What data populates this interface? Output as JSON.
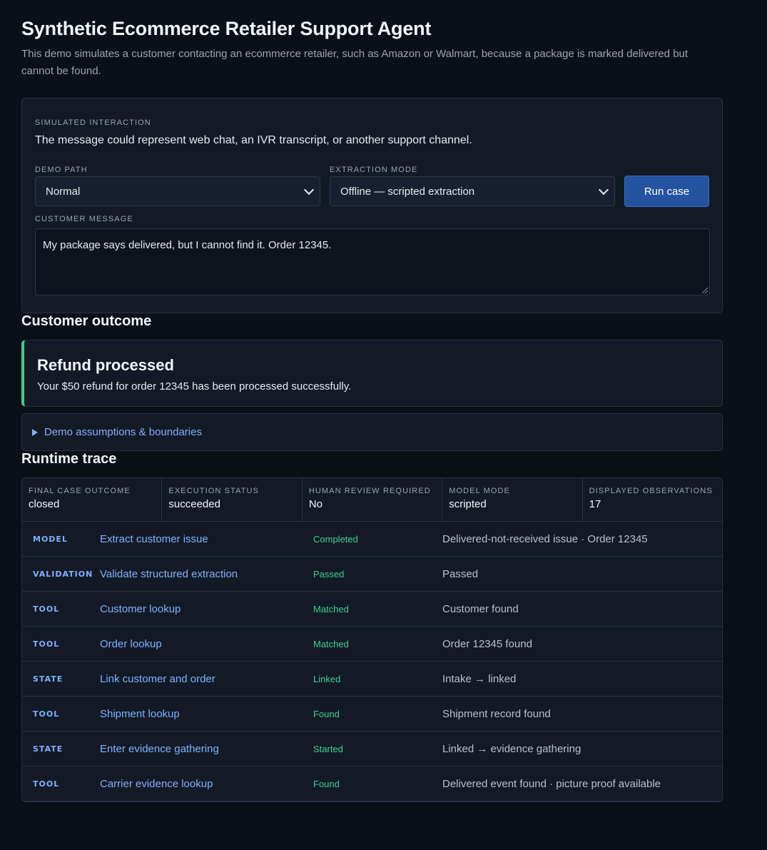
{
  "header": {
    "title": "Synthetic Ecommerce Retailer Support Agent",
    "subtitle": "This demo simulates a customer contacting an ecommerce retailer, such as Amazon or Walmart, because a package is marked delivered but cannot be found."
  },
  "interaction": {
    "section_label": "SIMULATED INTERACTION",
    "description": "The message could represent web chat, an IVR transcript, or another support channel.",
    "demo_path_label": "DEMO PATH",
    "demo_path_value": "Normal",
    "extraction_mode_label": "EXTRACTION MODE",
    "extraction_mode_value": "Offline — scripted extraction",
    "run_button": "Run case",
    "message_label": "CUSTOMER MESSAGE",
    "message_value": "My package says delivered, but I cannot find it. Order 12345."
  },
  "outcome": {
    "heading": "Customer outcome",
    "title": "Refund processed",
    "text": "Your $50 refund for order 12345 has been processed successfully.",
    "accent_color": "#3ecf8e",
    "assumptions_label": "Demo assumptions & boundaries"
  },
  "trace": {
    "heading": "Runtime trace",
    "summary": [
      {
        "label": "FINAL CASE OUTCOME",
        "value": "closed"
      },
      {
        "label": "EXECUTION STATUS",
        "value": "succeeded"
      },
      {
        "label": "HUMAN REVIEW REQUIRED",
        "value": "No"
      },
      {
        "label": "MODEL MODE",
        "value": "scripted"
      },
      {
        "label": "DISPLAYED OBSERVATIONS",
        "value": "17"
      }
    ],
    "rows": [
      {
        "kind": "MODEL",
        "step": "Extract customer issue",
        "status": "Completed",
        "detail": "Delivered-not-received issue · Order 12345"
      },
      {
        "kind": "VALIDATION",
        "step": "Validate structured extraction",
        "status": "Passed",
        "detail": "Passed"
      },
      {
        "kind": "TOOL",
        "step": "Customer lookup",
        "status": "Matched",
        "detail": "Customer found"
      },
      {
        "kind": "TOOL",
        "step": "Order lookup",
        "status": "Matched",
        "detail": "Order 12345 found"
      },
      {
        "kind": "STATE",
        "step": "Link customer and order",
        "status": "Linked",
        "detail": "Intake → linked"
      },
      {
        "kind": "TOOL",
        "step": "Shipment lookup",
        "status": "Found",
        "detail": "Shipment record found"
      },
      {
        "kind": "STATE",
        "step": "Enter evidence gathering",
        "status": "Started",
        "detail": "Linked → evidence gathering"
      },
      {
        "kind": "TOOL",
        "step": "Carrier evidence lookup",
        "status": "Found",
        "detail": "Delivered event found · picture proof available"
      }
    ]
  }
}
